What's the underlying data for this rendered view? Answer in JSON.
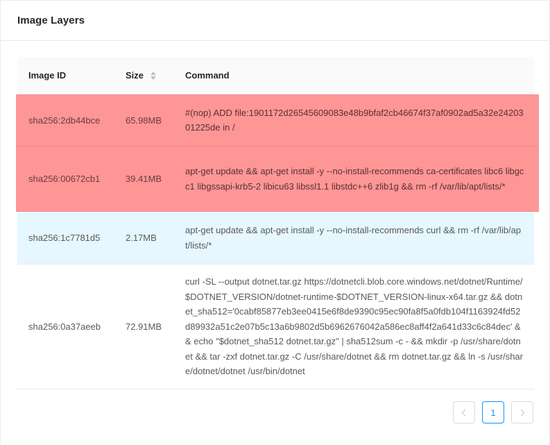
{
  "card": {
    "title": "Image Layers"
  },
  "table": {
    "columns": {
      "id": "Image ID",
      "size": "Size",
      "command": "Command"
    },
    "rows": [
      {
        "id": "sha256:2db44bce",
        "size": "65.98MB",
        "command": "#(nop) ADD file:1901172d26545609083e48b9bfaf2cb46674f37af0902ad5a32e2420301225de in /",
        "highlight": "red"
      },
      {
        "id": "sha256:00672cb1",
        "size": "39.41MB",
        "command": "apt-get update && apt-get install -y --no-install-recommends ca-certificates libc6 libgcc1 libgssapi-krb5-2 libicu63 libssl1.1 libstdc++6 zlib1g && rm -rf /var/lib/apt/lists/*",
        "highlight": "red"
      },
      {
        "id": "sha256:1c7781d5",
        "size": "2.17MB",
        "command": "apt-get update && apt-get install -y --no-install-recommends curl && rm -rf /var/lib/apt/lists/*",
        "highlight": "blue"
      },
      {
        "id": "sha256:0a37aeeb",
        "size": "72.91MB",
        "command": "curl -SL --output dotnet.tar.gz https://dotnetcli.blob.core.windows.net/dotnet/Runtime/$DOTNET_VERSION/dotnet-runtime-$DOTNET_VERSION-linux-x64.tar.gz && dotnet_sha512='0cabf85877eb3ee0415e6f8de9390c95ec90fa8f5a0fdb104f1163924fd52d89932a51c2e07b5c13a6b9802d5b6962676042a586ec8aff4f2a641d33c6c84dec' && echo \"$dotnet_sha512 dotnet.tar.gz\" | sha512sum -c - && mkdir -p /usr/share/dotnet && tar -zxf dotnet.tar.gz -C /usr/share/dotnet && rm dotnet.tar.gz && ln -s /usr/share/dotnet/dotnet /usr/bin/dotnet",
        "highlight": "none"
      }
    ]
  },
  "pagination": {
    "current_page": "1"
  },
  "colors": {
    "highlight_red": "#ff9696",
    "highlight_blue": "#e6f7ff",
    "accent": "#1890ff"
  },
  "icons": {
    "sort": "sort-icon",
    "prev": "chevron-left-icon",
    "next": "chevron-right-icon"
  }
}
